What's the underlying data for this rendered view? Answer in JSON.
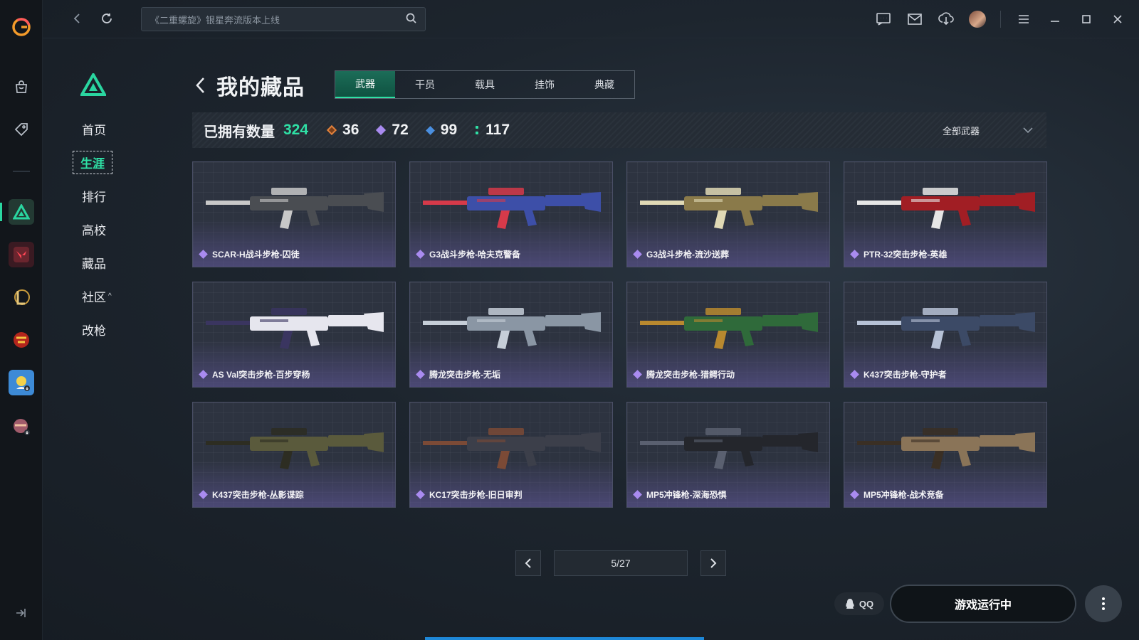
{
  "search": {
    "placeholder": "《二重螺旋》银星奔流版本上线"
  },
  "subnav": {
    "items": [
      {
        "label": "首页"
      },
      {
        "label": "生涯"
      },
      {
        "label": "排行"
      },
      {
        "label": "高校"
      },
      {
        "label": "藏品"
      },
      {
        "label": "社区"
      },
      {
        "label": "改枪"
      }
    ],
    "active_index": 1
  },
  "page": {
    "title": "我的藏品"
  },
  "tabs": [
    {
      "label": "武器"
    },
    {
      "label": "干员"
    },
    {
      "label": "载具"
    },
    {
      "label": "挂饰"
    },
    {
      "label": "典藏"
    }
  ],
  "stats": {
    "owned_label": "已拥有数量",
    "owned_total": "324",
    "counts": [
      {
        "value": "36",
        "color": "#e0813c",
        "icon": "orange-diamond-icon"
      },
      {
        "value": "72",
        "color": "#a98bf0",
        "icon": "purple-diamond-icon"
      },
      {
        "value": "99",
        "color": "#4a8fe0",
        "icon": "blue-diamond-icon"
      },
      {
        "value": "117",
        "color": "#2fe0a5",
        "icon": "green-dots-icon"
      }
    ],
    "filter_label": "全部武器"
  },
  "items": [
    {
      "name": "SCAR-H战斗步枪-囚徒",
      "body": "#4a4d52",
      "accent": "#c8c8c8"
    },
    {
      "name": "G3战斗步枪-哈夫克警备",
      "body": "#3d4fa8",
      "accent": "#d63a4a"
    },
    {
      "name": "G3战斗步枪-流沙送葬",
      "body": "#8a7a4a",
      "accent": "#e0d9b5"
    },
    {
      "name": "PTR-32突击步枪-英雄",
      "body": "#a11e24",
      "accent": "#e6e6e6"
    },
    {
      "name": "AS Val突击步枪-百步穿杨",
      "body": "#e6e6ee",
      "accent": "#3a3560"
    },
    {
      "name": "腾龙突击步枪-无垢",
      "body": "#8a96a4",
      "accent": "#c6ced8"
    },
    {
      "name": "腾龙突击步枪-猎鳄行动",
      "body": "#2f6a3a",
      "accent": "#b9892f"
    },
    {
      "name": "K437突击步枪-守护者",
      "body": "#3c4a66",
      "accent": "#b7c2d6"
    },
    {
      "name": "K437突击步枪-丛影谍踪",
      "body": "#5a5a3c",
      "accent": "#2d2d22"
    },
    {
      "name": "KC17突击步枪-旧日审判",
      "body": "#3c3f4a",
      "accent": "#7b4a36"
    },
    {
      "name": "MP5冲锋枪-深海恐惧",
      "body": "#24262c",
      "accent": "#5a6070"
    },
    {
      "name": "MP5冲锋枪-战术竞备",
      "body": "#8a7458",
      "accent": "#3a2f24"
    }
  ],
  "pager": {
    "current": "5/27"
  },
  "footer": {
    "qq_label": "QQ",
    "launch_label": "游戏运行中"
  }
}
